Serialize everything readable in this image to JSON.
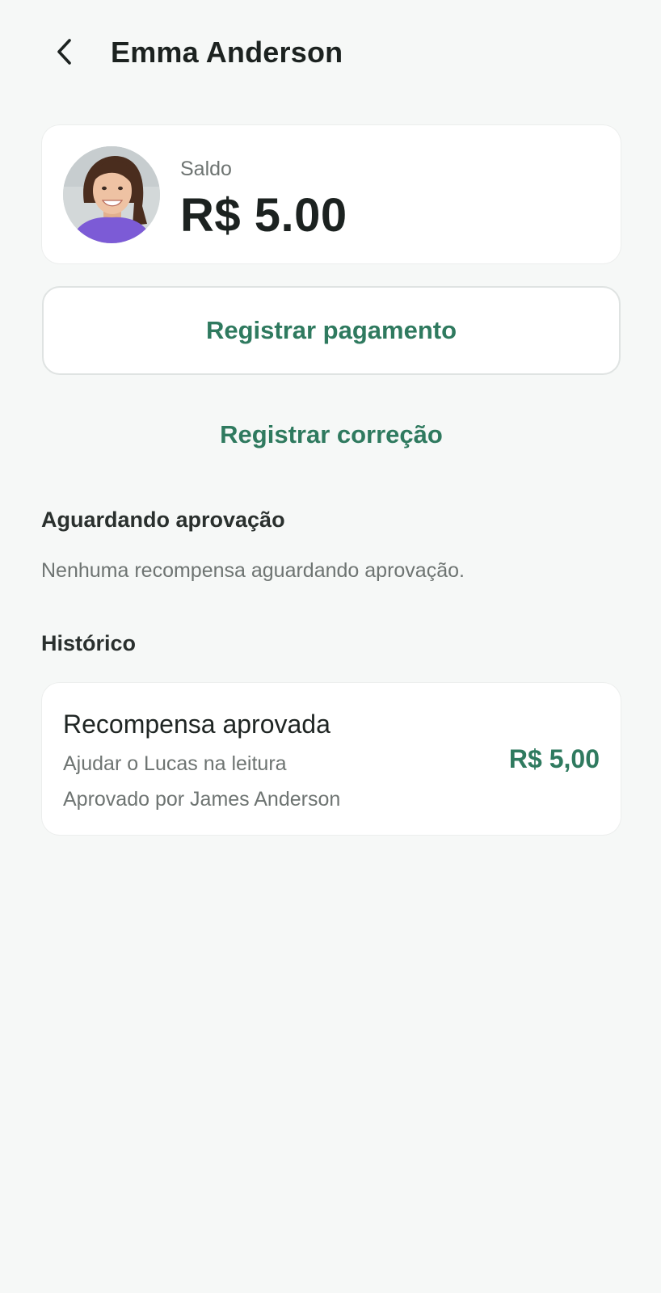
{
  "header": {
    "title": "Emma Anderson",
    "back_icon": "chevron-left-icon"
  },
  "balance": {
    "label": "Saldo",
    "value": "R$ 5.00",
    "avatar": "child-avatar-photo"
  },
  "actions": {
    "register_payment": "Registrar pagamento",
    "register_correction": "Registrar correção"
  },
  "pending": {
    "title": "Aguardando aprovação",
    "empty_message": "Nenhuma recompensa aguardando aprovação."
  },
  "history": {
    "title": "Histórico",
    "items": [
      {
        "title": "Recompensa aprovada",
        "description": "Ajudar o Lucas na leitura",
        "approver": "Aprovado por James Anderson",
        "amount": "R$ 5,00"
      }
    ]
  },
  "colors": {
    "accent": "#2f7a5f",
    "background": "#f6f8f7",
    "card": "#ffffff",
    "muted_text": "#6e7472"
  }
}
